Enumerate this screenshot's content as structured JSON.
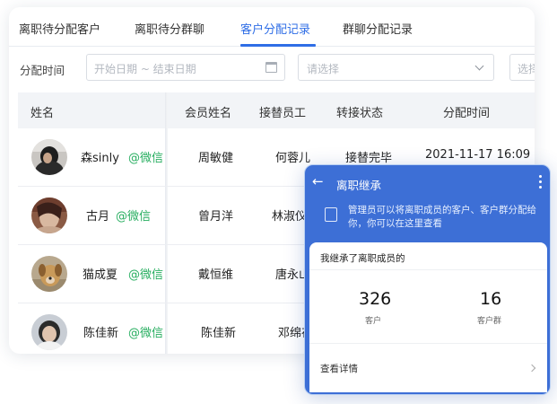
{
  "tabs": [
    {
      "label": "离职待分配客户"
    },
    {
      "label": "离职待分群聊"
    },
    {
      "label": "客户分配记录",
      "active": true
    },
    {
      "label": "群聊分配记录"
    }
  ],
  "filters": {
    "time_label": "分配时间",
    "date_placeholder": "开始日期 ~ 结束日期",
    "select_placeholder": "请选择",
    "select2_placeholder": "选择"
  },
  "table": {
    "headers": [
      "姓名",
      "会员姓名",
      "接替员工",
      "转接状态",
      "分配时间"
    ],
    "rows": [
      {
        "name": "森sinly",
        "source": "@微信",
        "member": "周敏健",
        "successor": "何蓉儿",
        "status": "接替完毕",
        "time": "2021-11-17 16:09"
      },
      {
        "name": "古月",
        "source": "@微信",
        "member": "曾月洋",
        "successor": "林淑仪",
        "status": "",
        "time": ""
      },
      {
        "name": "猫成夏",
        "source": "@微信",
        "member": "戴恒维",
        "successor": "唐永山",
        "status": "",
        "time": ""
      },
      {
        "name": "陈佳新",
        "source": "@微信",
        "member": "陈佳新",
        "successor": "邓绵存",
        "status": "",
        "time": ""
      }
    ]
  },
  "phone": {
    "title": "离职继承",
    "description": "管理员可以将离职成员的客户、客户群分配给你，你可以在这里查看",
    "panel_title": "我继承了离职成员的",
    "stats": [
      {
        "value": "326",
        "label": "客户"
      },
      {
        "value": "16",
        "label": "客户群"
      }
    ],
    "detail_label": "查看详情"
  },
  "colors": {
    "accent": "#2f6ee6",
    "wechat_green": "#27ae60",
    "phone_blue": "#3d6fd6"
  }
}
